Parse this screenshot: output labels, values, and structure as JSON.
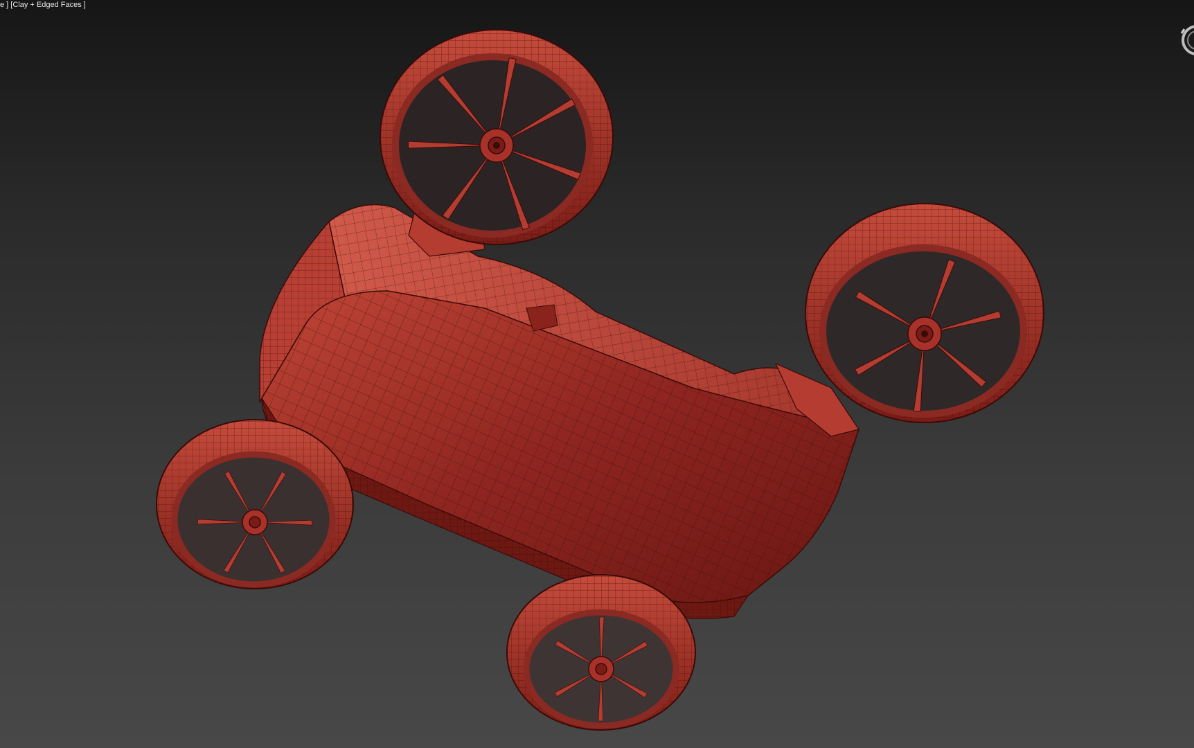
{
  "viewport": {
    "label": "e ] [Clay + Edged Faces ]"
  },
  "colors": {
    "clay_body": "#a8322a",
    "clay_light": "#cf5848",
    "clay_dark": "#5e1410",
    "edge_line": "#3a0a08",
    "bg_top": "#161616",
    "bg_bottom": "#484848"
  },
  "scene": {
    "object": "drone-car",
    "parts": [
      "body",
      "front-rotor",
      "right-rotor",
      "left-wheel",
      "bottom-wheel"
    ]
  },
  "icons": {
    "viewcube": "viewcube-icon"
  }
}
